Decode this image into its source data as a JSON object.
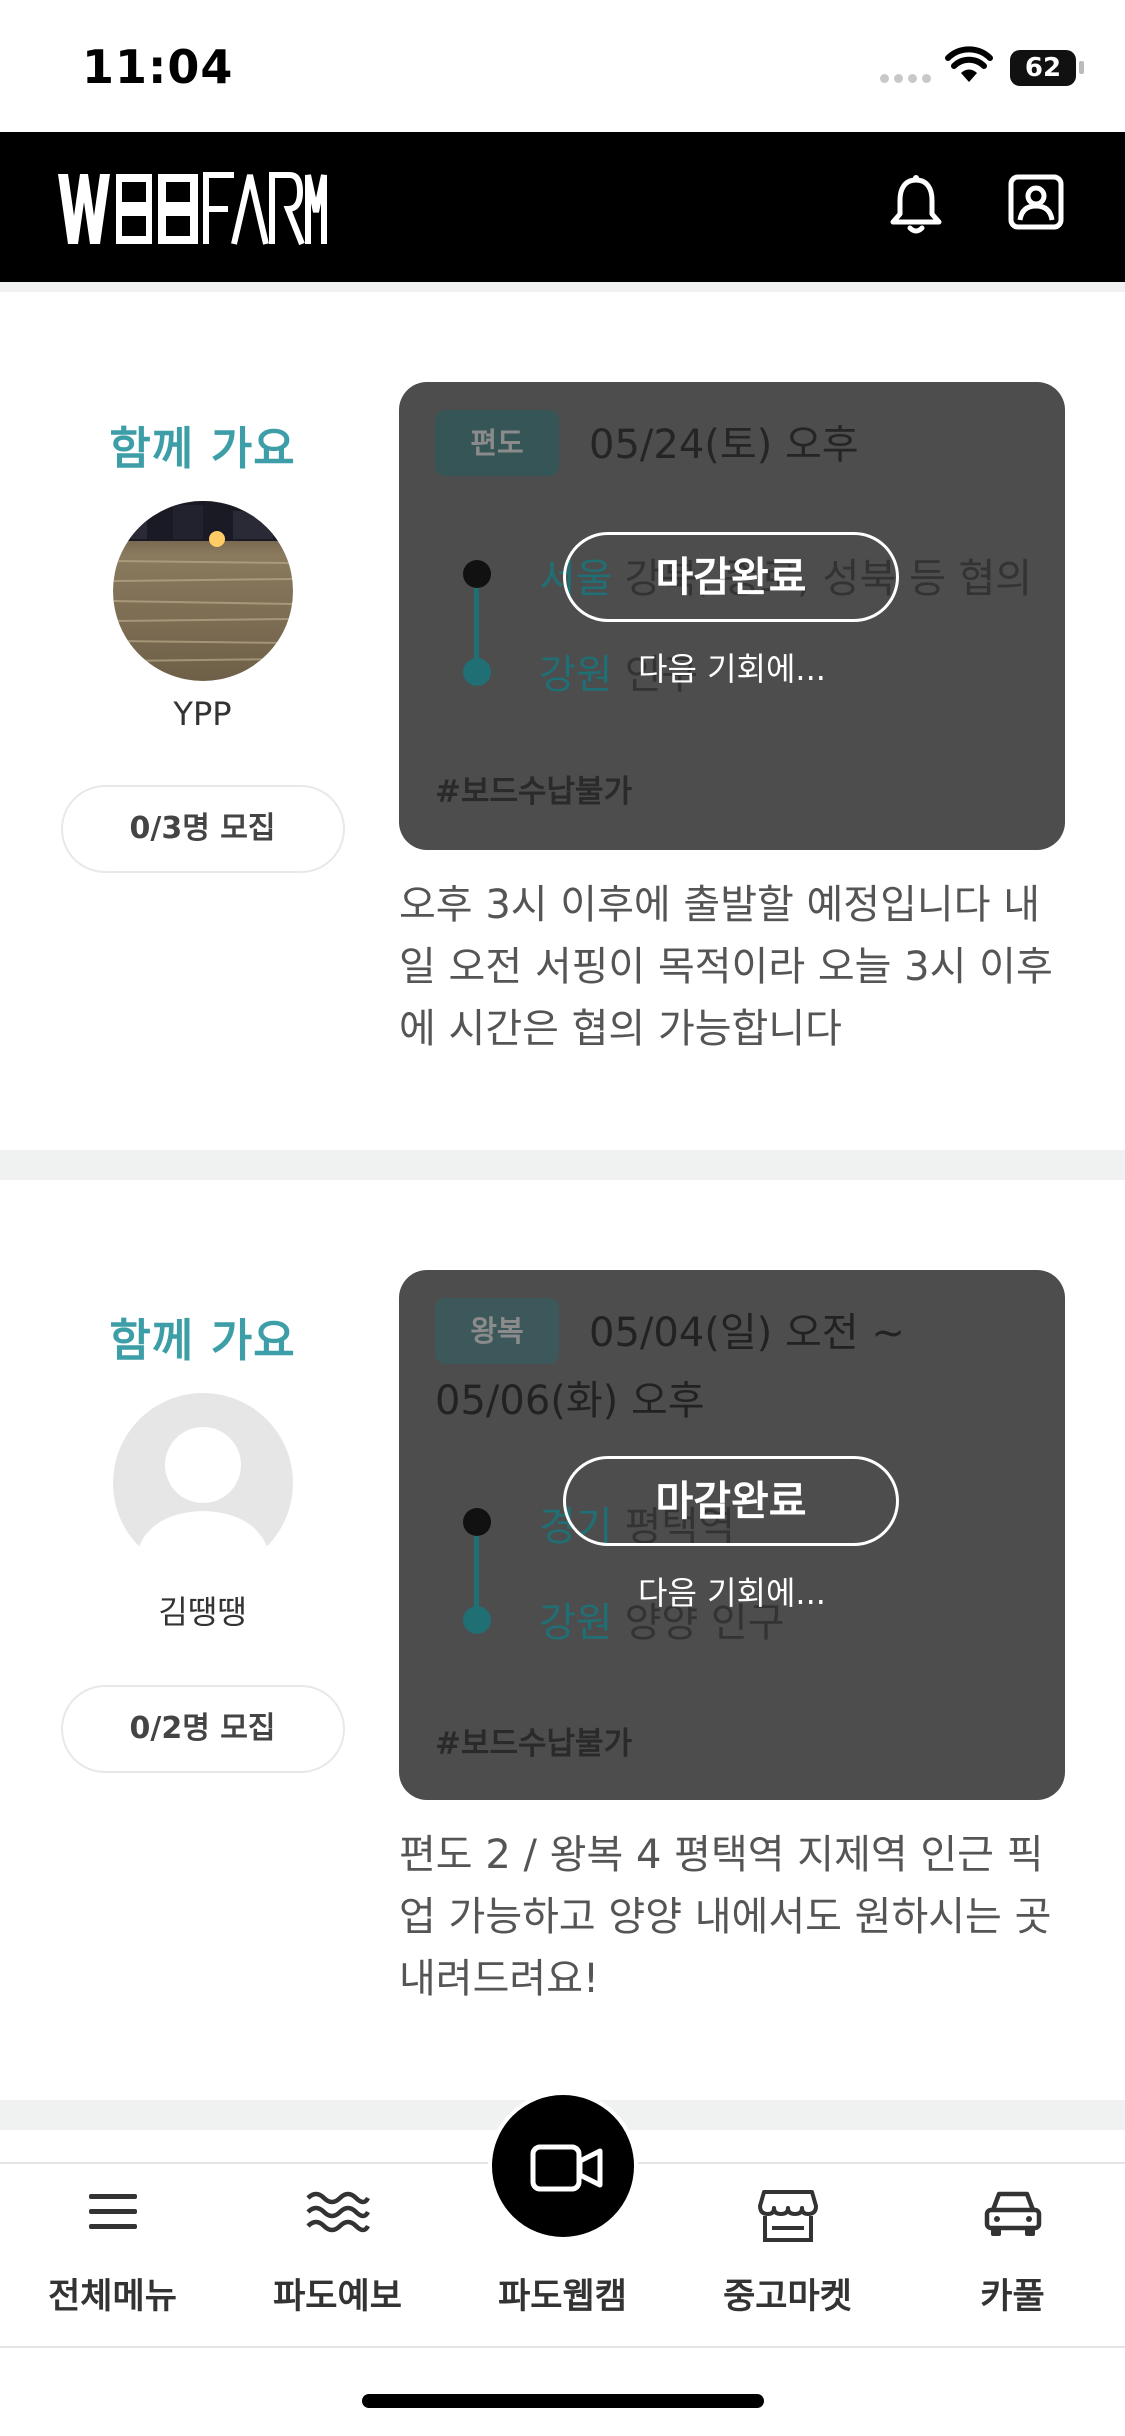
{
  "status_bar": {
    "time": "11:04",
    "battery": "62"
  },
  "header": {
    "logo_text": "WSB FARM",
    "notification_icon": "bell-icon",
    "profile_icon": "user-square-icon"
  },
  "posts": [
    {
      "together_label": "함께 가요",
      "username": "YPP",
      "recruit": "0/3명 모집",
      "type": "편도",
      "datetime": "05/24(토) 오후",
      "datetime_2": "",
      "from_region": "서울",
      "from_place": "강북, 종로, 성북 등 협의",
      "to_region": "강원",
      "to_place": "인구",
      "tag": "#보드수납불가",
      "status": "마감완료",
      "status_sub": "다음 기회에...",
      "description": "오후 3시 이후에 출발할 예정입니다 내일 오전 서핑이 목적이라 오늘 3시 이후에 시간은 협의 가능합니다"
    },
    {
      "together_label": "함께 가요",
      "username": "김땡땡",
      "recruit": "0/2명 모집",
      "type": "왕복",
      "datetime": "05/04(일) 오전 ~",
      "datetime_2": "05/06(화) 오후",
      "from_region": "경기",
      "from_place": "평택역",
      "to_region": "강원",
      "to_place": "양양 인구",
      "tag": "#보드수납불가",
      "status": "마감완료",
      "status_sub": "다음 기회에...",
      "description": "편도 2 / 왕복 4 평택역 지제역 인근 픽업 가능하고 양양 내에서도 원하시는 곳 내려드려요!"
    }
  ],
  "tabbar": {
    "items": [
      {
        "label": "전체메뉴",
        "icon": "menu-icon"
      },
      {
        "label": "파도예보",
        "icon": "waves-icon"
      },
      {
        "label": "파도웹캠",
        "icon": "video-camera-icon"
      },
      {
        "label": "중고마켓",
        "icon": "store-icon"
      },
      {
        "label": "카풀",
        "icon": "car-icon"
      }
    ]
  },
  "colors": {
    "accent": "#3e9ea8",
    "badge": "#1f6f75",
    "overlay": "#464646",
    "header": "#000000"
  }
}
